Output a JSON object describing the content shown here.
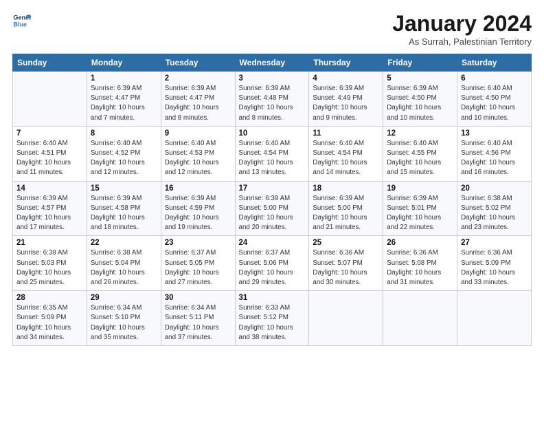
{
  "logo": {
    "line1": "General",
    "line2": "Blue"
  },
  "title": "January 2024",
  "location": "As Surrah, Palestinian Territory",
  "days_header": [
    "Sunday",
    "Monday",
    "Tuesday",
    "Wednesday",
    "Thursday",
    "Friday",
    "Saturday"
  ],
  "weeks": [
    [
      {
        "num": "",
        "info": ""
      },
      {
        "num": "1",
        "info": "Sunrise: 6:39 AM\nSunset: 4:47 PM\nDaylight: 10 hours\nand 7 minutes."
      },
      {
        "num": "2",
        "info": "Sunrise: 6:39 AM\nSunset: 4:47 PM\nDaylight: 10 hours\nand 8 minutes."
      },
      {
        "num": "3",
        "info": "Sunrise: 6:39 AM\nSunset: 4:48 PM\nDaylight: 10 hours\nand 8 minutes."
      },
      {
        "num": "4",
        "info": "Sunrise: 6:39 AM\nSunset: 4:49 PM\nDaylight: 10 hours\nand 9 minutes."
      },
      {
        "num": "5",
        "info": "Sunrise: 6:39 AM\nSunset: 4:50 PM\nDaylight: 10 hours\nand 10 minutes."
      },
      {
        "num": "6",
        "info": "Sunrise: 6:40 AM\nSunset: 4:50 PM\nDaylight: 10 hours\nand 10 minutes."
      }
    ],
    [
      {
        "num": "7",
        "info": "Sunrise: 6:40 AM\nSunset: 4:51 PM\nDaylight: 10 hours\nand 11 minutes."
      },
      {
        "num": "8",
        "info": "Sunrise: 6:40 AM\nSunset: 4:52 PM\nDaylight: 10 hours\nand 12 minutes."
      },
      {
        "num": "9",
        "info": "Sunrise: 6:40 AM\nSunset: 4:53 PM\nDaylight: 10 hours\nand 12 minutes."
      },
      {
        "num": "10",
        "info": "Sunrise: 6:40 AM\nSunset: 4:54 PM\nDaylight: 10 hours\nand 13 minutes."
      },
      {
        "num": "11",
        "info": "Sunrise: 6:40 AM\nSunset: 4:54 PM\nDaylight: 10 hours\nand 14 minutes."
      },
      {
        "num": "12",
        "info": "Sunrise: 6:40 AM\nSunset: 4:55 PM\nDaylight: 10 hours\nand 15 minutes."
      },
      {
        "num": "13",
        "info": "Sunrise: 6:40 AM\nSunset: 4:56 PM\nDaylight: 10 hours\nand 16 minutes."
      }
    ],
    [
      {
        "num": "14",
        "info": "Sunrise: 6:39 AM\nSunset: 4:57 PM\nDaylight: 10 hours\nand 17 minutes."
      },
      {
        "num": "15",
        "info": "Sunrise: 6:39 AM\nSunset: 4:58 PM\nDaylight: 10 hours\nand 18 minutes."
      },
      {
        "num": "16",
        "info": "Sunrise: 6:39 AM\nSunset: 4:59 PM\nDaylight: 10 hours\nand 19 minutes."
      },
      {
        "num": "17",
        "info": "Sunrise: 6:39 AM\nSunset: 5:00 PM\nDaylight: 10 hours\nand 20 minutes."
      },
      {
        "num": "18",
        "info": "Sunrise: 6:39 AM\nSunset: 5:00 PM\nDaylight: 10 hours\nand 21 minutes."
      },
      {
        "num": "19",
        "info": "Sunrise: 6:39 AM\nSunset: 5:01 PM\nDaylight: 10 hours\nand 22 minutes."
      },
      {
        "num": "20",
        "info": "Sunrise: 6:38 AM\nSunset: 5:02 PM\nDaylight: 10 hours\nand 23 minutes."
      }
    ],
    [
      {
        "num": "21",
        "info": "Sunrise: 6:38 AM\nSunset: 5:03 PM\nDaylight: 10 hours\nand 25 minutes."
      },
      {
        "num": "22",
        "info": "Sunrise: 6:38 AM\nSunset: 5:04 PM\nDaylight: 10 hours\nand 26 minutes."
      },
      {
        "num": "23",
        "info": "Sunrise: 6:37 AM\nSunset: 5:05 PM\nDaylight: 10 hours\nand 27 minutes."
      },
      {
        "num": "24",
        "info": "Sunrise: 6:37 AM\nSunset: 5:06 PM\nDaylight: 10 hours\nand 29 minutes."
      },
      {
        "num": "25",
        "info": "Sunrise: 6:36 AM\nSunset: 5:07 PM\nDaylight: 10 hours\nand 30 minutes."
      },
      {
        "num": "26",
        "info": "Sunrise: 6:36 AM\nSunset: 5:08 PM\nDaylight: 10 hours\nand 31 minutes."
      },
      {
        "num": "27",
        "info": "Sunrise: 6:36 AM\nSunset: 5:09 PM\nDaylight: 10 hours\nand 33 minutes."
      }
    ],
    [
      {
        "num": "28",
        "info": "Sunrise: 6:35 AM\nSunset: 5:09 PM\nDaylight: 10 hours\nand 34 minutes."
      },
      {
        "num": "29",
        "info": "Sunrise: 6:34 AM\nSunset: 5:10 PM\nDaylight: 10 hours\nand 35 minutes."
      },
      {
        "num": "30",
        "info": "Sunrise: 6:34 AM\nSunset: 5:11 PM\nDaylight: 10 hours\nand 37 minutes."
      },
      {
        "num": "31",
        "info": "Sunrise: 6:33 AM\nSunset: 5:12 PM\nDaylight: 10 hours\nand 38 minutes."
      },
      {
        "num": "",
        "info": ""
      },
      {
        "num": "",
        "info": ""
      },
      {
        "num": "",
        "info": ""
      }
    ]
  ]
}
